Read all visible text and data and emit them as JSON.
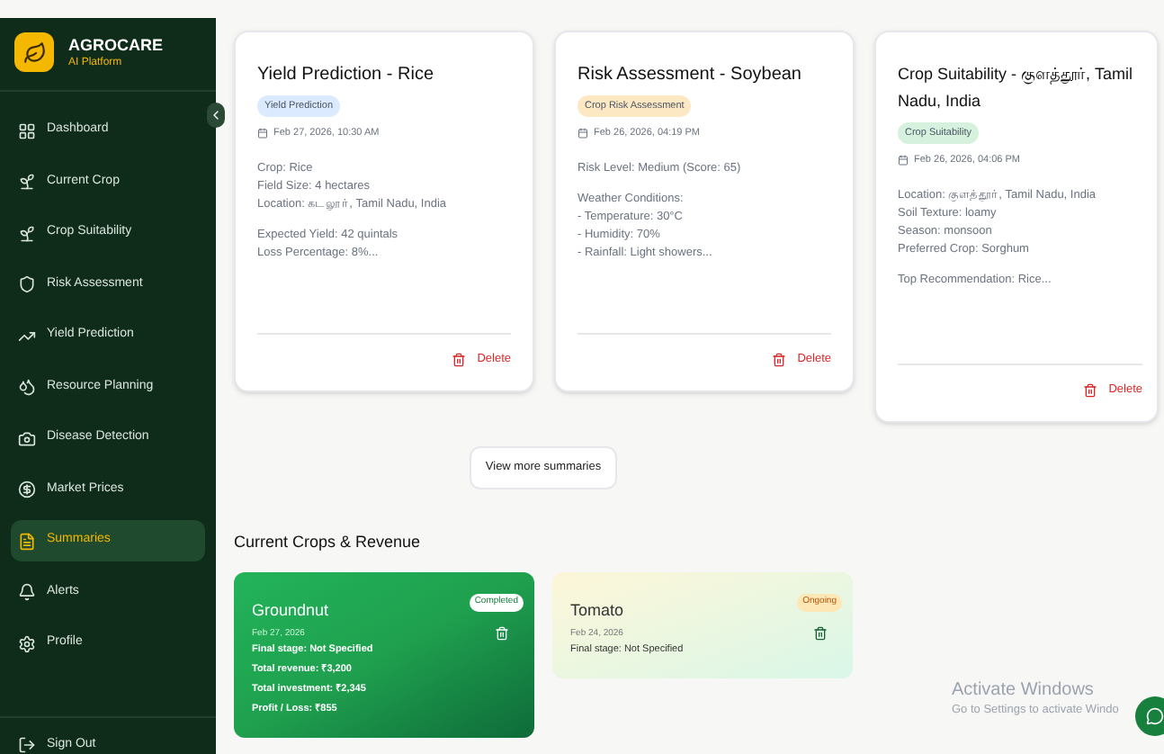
{
  "brand": {
    "name": "AGROCARE",
    "subtitle": "AI Platform"
  },
  "sidebar": {
    "items": [
      {
        "label": "Dashboard",
        "selected": false
      },
      {
        "label": "Current Crop",
        "selected": false
      },
      {
        "label": "Crop Suitability",
        "selected": false
      },
      {
        "label": "Risk Assessment",
        "selected": false
      },
      {
        "label": "Yield Prediction",
        "selected": false
      },
      {
        "label": "Resource Planning",
        "selected": false
      },
      {
        "label": "Disease Detection",
        "selected": false
      },
      {
        "label": "Market Prices",
        "selected": false
      },
      {
        "label": "Summaries",
        "selected": true
      },
      {
        "label": "Alerts",
        "selected": false
      },
      {
        "label": "Profile",
        "selected": false
      }
    ],
    "sign_out": "Sign Out"
  },
  "summaries": [
    {
      "title": "Yield Prediction - Rice",
      "tag": "Yield Prediction",
      "color": "#dbeafe",
      "date": "Feb 27, 2026, 10:30 AM",
      "paragraphs": [
        [
          "Crop: Rice",
          "Field Size: 4 hectares",
          "Location: கடலூர், Tamil Nadu, India"
        ],
        [
          "Expected Yield: 42 quintals",
          "Loss Percentage: 8%..."
        ]
      ],
      "delete": "Delete"
    },
    {
      "title": "Risk Assessment - Soybean",
      "tag": "Crop Risk Assessment",
      "color": "#fde8c4",
      "date": "Feb 26, 2026, 04:19 PM",
      "paragraphs": [
        [
          "Risk Level: Medium (Score: 65)"
        ],
        [
          "Weather Conditions:",
          "- Temperature: 30°C",
          "- Humidity: 70%",
          "- Rainfall: Light showers..."
        ]
      ],
      "delete": "Delete"
    },
    {
      "title": "Crop Suitability - குளத்தூர், Tamil Nadu, India",
      "tag": "Crop Suitability",
      "color": "#d6f2df",
      "date": "Feb 26, 2026, 04:06 PM",
      "paragraphs": [
        [
          "Location: குளத்தூர், Tamil Nadu, India",
          "Soil Texture: loamy",
          "Season: monsoon",
          "Preferred Crop: Sorghum"
        ],
        [
          "Top Recommendation: Rice..."
        ]
      ],
      "delete": "Delete"
    }
  ],
  "view_more": "View more summaries",
  "crops_section": {
    "title": "Current Crops & Revenue",
    "crops": [
      {
        "name": "Groundnut",
        "status": "Completed",
        "kind": "completed",
        "date": "Feb 27, 2026",
        "lines": [
          "Final stage: Not Specified",
          "Total revenue: ₹3,200",
          "Total investment: ₹2,345",
          "Profit / Loss: ₹855"
        ]
      },
      {
        "name": "Tomato",
        "status": "Ongoing",
        "kind": "ongoing",
        "date": "Feb 24, 2026",
        "lines": [
          "Final stage: Not Specified"
        ]
      }
    ]
  },
  "watermark": {
    "title": "Activate Windows",
    "subtitle": "Go to Settings to activate Windo"
  }
}
